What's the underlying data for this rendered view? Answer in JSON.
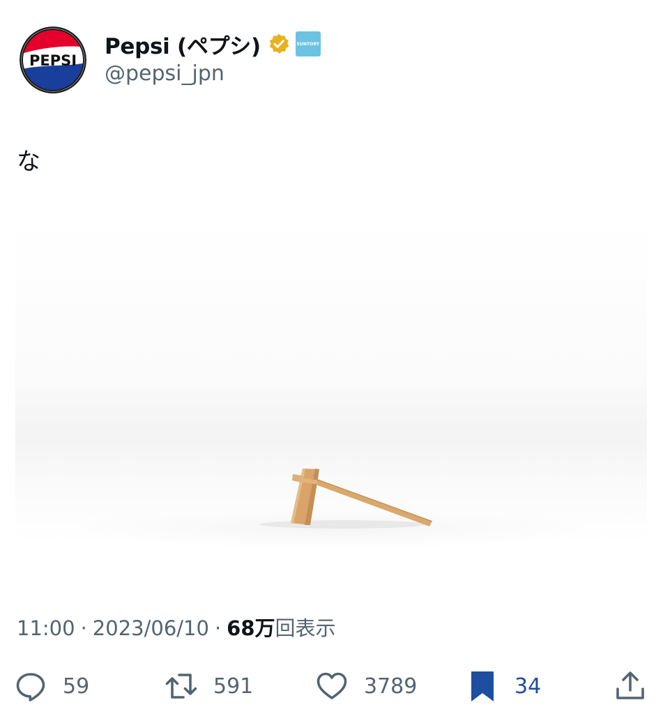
{
  "author": {
    "display_name": "Pepsi (ペプシ)",
    "handle": "@pepsi_jpn",
    "avatar_text": "PEPSI",
    "verified": true,
    "verified_badge_color": "#e8b21c",
    "affiliate_badge_text": "SUNTORY",
    "affiliate_badge_color": "#6cc3e1"
  },
  "tweet": {
    "text": "な"
  },
  "meta": {
    "time": "11:00",
    "separator": "·",
    "date": "2023/06/10",
    "views_count": "68万",
    "views_label": "回表示"
  },
  "actions": {
    "reply": {
      "icon": "reply-icon",
      "count": "59"
    },
    "retweet": {
      "icon": "retweet-icon",
      "count": "591"
    },
    "like": {
      "icon": "heart-icon",
      "count": "3789"
    },
    "bookmark": {
      "icon": "bookmark-icon",
      "count": "34",
      "active": true,
      "color": "#1d4ea0"
    },
    "share": {
      "icon": "share-icon"
    }
  },
  "colors": {
    "text_primary": "#0f1419",
    "text_secondary": "#536471",
    "pepsi_red": "#e4002b",
    "pepsi_blue": "#1a3e9b"
  }
}
